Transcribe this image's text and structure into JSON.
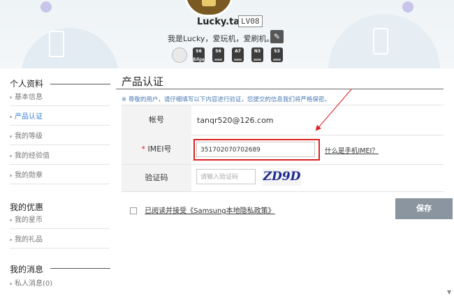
{
  "header": {
    "username": "Lucky.tan",
    "level": "LV08",
    "bio": "我是Lucky，爱玩机，爱刷机。",
    "edit_icon": "✎",
    "devices": [
      "",
      "S6\nEdge",
      "S6",
      "A7",
      "N3",
      "S3"
    ]
  },
  "sidebar": {
    "sections": [
      {
        "title": "个人资料",
        "items": [
          "基本信息",
          "产品认证",
          "我的等级",
          "我的经验值",
          "我的勋章"
        ]
      },
      {
        "title": "我的优惠",
        "items": [
          "我的星币",
          "我的礼品"
        ]
      },
      {
        "title": "我的消息",
        "items": [
          "私人消息(0)"
        ]
      }
    ],
    "active_item": "产品认证"
  },
  "main": {
    "title": "产品认证",
    "notice": "※ 尊敬的用户，请仔细填写以下内容进行验证，您提交的信息我们将严格保密。",
    "account": {
      "label": "帐号",
      "value": "tanqr520@126.com"
    },
    "imei": {
      "required_mark": "*",
      "label": "IMEI号",
      "value": "351702070702689",
      "help_link": "什么是手机IMEI？"
    },
    "captcha": {
      "label": "验证码",
      "placeholder": "请输入验证码",
      "image_text": "ZD9D"
    },
    "agreement": "已阅读并接受《Samsung本地隐私政策》",
    "save_button": "保存"
  },
  "colors": {
    "accent_link": "#3a7fd5",
    "highlight_box": "#e02020",
    "save_button_bg": "#8a95a0",
    "notice_text": "#4a7ab3"
  }
}
